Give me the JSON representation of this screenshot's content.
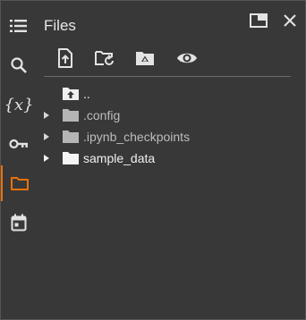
{
  "panel": {
    "title": "Files"
  },
  "rail": {
    "items": [
      {
        "icon": "table-of-contents-icon"
      },
      {
        "icon": "search-icon"
      },
      {
        "icon": "variables-icon",
        "glyph": "{𝑥}"
      },
      {
        "icon": "key-icon"
      },
      {
        "icon": "folder-icon",
        "active": true
      },
      {
        "icon": "calendar-icon"
      }
    ]
  },
  "header_icons": [
    "open-in-tab-icon",
    "close-icon"
  ],
  "toolbar": [
    "upload-icon",
    "refresh-folder-icon",
    "mount-drive-icon",
    "show-hidden-icon"
  ],
  "files": [
    {
      "name": "..",
      "type": "parent",
      "expandable": false
    },
    {
      "name": ".config",
      "type": "folder",
      "expandable": true,
      "hidden": true
    },
    {
      "name": ".ipynb_checkpoints",
      "type": "folder",
      "expandable": true,
      "hidden": true
    },
    {
      "name": "sample_data",
      "type": "folder",
      "expandable": true,
      "hidden": false
    }
  ],
  "colors": {
    "accent": "#e8710a",
    "background": "#383838",
    "text": "#e3e3e3"
  }
}
